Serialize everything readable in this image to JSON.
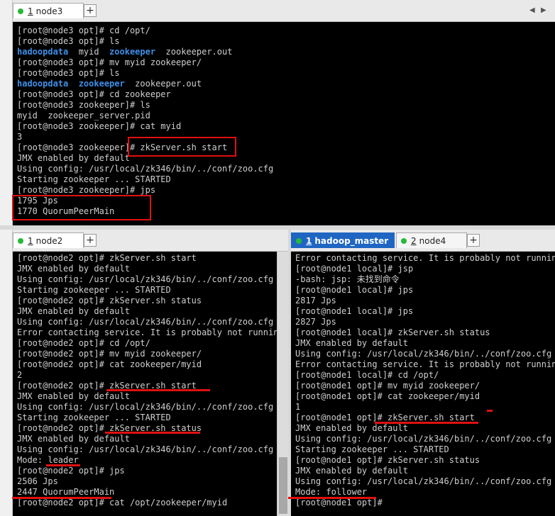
{
  "top_pane": {
    "tabs": [
      {
        "index": "1",
        "label": "node3",
        "active": true
      }
    ],
    "plus_label": "+",
    "nav_left_icon": "◀",
    "nav_right_icon": "▶",
    "lines": [
      [
        {
          "t": "[root@node3 opt]# cd /opt/"
        }
      ],
      [
        {
          "t": "[root@node3 opt]# ls"
        }
      ],
      [
        {
          "t": "hadoopdata",
          "c": "dir"
        },
        {
          "t": "  myid  "
        },
        {
          "t": "zookeeper",
          "c": "dir"
        },
        {
          "t": "  zookeeper.out"
        }
      ],
      [
        {
          "t": "[root@node3 opt]# mv myid zookeeper/"
        }
      ],
      [
        {
          "t": "[root@node3 opt]# ls"
        }
      ],
      [
        {
          "t": "hadoopdata",
          "c": "dir"
        },
        {
          "t": "  "
        },
        {
          "t": "zookeeper",
          "c": "dir"
        },
        {
          "t": "  zookeeper.out"
        }
      ],
      [
        {
          "t": "[root@node3 opt]# cd zookeeper"
        }
      ],
      [
        {
          "t": "[root@node3 zookeeper]# ls"
        }
      ],
      [
        {
          "t": "myid  zookeeper_server.pid"
        }
      ],
      [
        {
          "t": "[root@node3 zookeeper]# cat myid"
        }
      ],
      [
        {
          "t": "3"
        }
      ],
      [
        {
          "t": "[root@node3 zookeeper]# zkServer.sh start"
        }
      ],
      [
        {
          "t": "JMX enabled by default"
        }
      ],
      [
        {
          "t": "Using config: /usr/local/zk346/bin/../conf/zoo.cfg"
        }
      ],
      [
        {
          "t": "Starting zookeeper ... STARTED"
        }
      ],
      [
        {
          "t": "[root@node3 zookeeper]# jps"
        }
      ],
      [
        {
          "t": "1795 Jps"
        }
      ],
      [
        {
          "t": "1770 QuorumPeerMain"
        }
      ]
    ]
  },
  "left_pane": {
    "tabs": [
      {
        "index": "1",
        "label": "node2",
        "active": true
      }
    ],
    "plus_label": "+",
    "lines": [
      [
        {
          "t": "[root@node2 opt]# zkServer.sh start"
        }
      ],
      [
        {
          "t": "JMX enabled by default"
        }
      ],
      [
        {
          "t": "Using config: /usr/local/zk346/bin/../conf/zoo.cfg"
        }
      ],
      [
        {
          "t": "Starting zookeeper ... STARTED"
        }
      ],
      [
        {
          "t": "[root@node2 opt]# zkServer.sh status"
        }
      ],
      [
        {
          "t": "JMX enabled by default"
        }
      ],
      [
        {
          "t": "Using config: /usr/local/zk346/bin/../conf/zoo.cfg"
        }
      ],
      [
        {
          "t": "Error contacting service. It is probably not runnin"
        }
      ],
      [
        {
          "t": "[root@node2 opt]# cd /opt/"
        }
      ],
      [
        {
          "t": "[root@node2 opt]# mv myid zookeeper/"
        }
      ],
      [
        {
          "t": "[root@node2 opt]# cat zookeeper/myid"
        }
      ],
      [
        {
          "t": "2"
        }
      ],
      [
        {
          "t": "[root@node2 opt]# zkServer.sh start"
        }
      ],
      [
        {
          "t": "JMX enabled by default"
        }
      ],
      [
        {
          "t": "Using config: /usr/local/zk346/bin/../conf/zoo.cfg"
        }
      ],
      [
        {
          "t": "Starting zookeeper ... STARTED"
        }
      ],
      [
        {
          "t": "[root@node2 opt]# zkServer.sh status"
        }
      ],
      [
        {
          "t": "JMX enabled by default"
        }
      ],
      [
        {
          "t": "Using config: /usr/local/zk346/bin/../conf/zoo.cfg"
        }
      ],
      [
        {
          "t": "Mode: leader"
        }
      ],
      [
        {
          "t": "[root@node2 opt]# jps"
        }
      ],
      [
        {
          "t": "2506 Jps"
        }
      ],
      [
        {
          "t": "2447 QuorumPeerMain"
        }
      ],
      [
        {
          "t": "[root@node2 opt]# cat /opt/zookeeper/myid"
        }
      ]
    ]
  },
  "right_pane": {
    "tabs": [
      {
        "index": "1",
        "label": "hadoop_master",
        "active": true
      },
      {
        "index": "2",
        "label": "node4",
        "active": false
      }
    ],
    "plus_label": "+",
    "lines": [
      [
        {
          "t": "Error contacting service. It is probably not runnin"
        }
      ],
      [
        {
          "t": "[root@node1 local]# jsp"
        }
      ],
      [
        {
          "t": "-bash: jsp: 未找到命令"
        }
      ],
      [
        {
          "t": "[root@node1 local]# jps"
        }
      ],
      [
        {
          "t": "2817 Jps"
        }
      ],
      [
        {
          "t": "[root@node1 local]# jps"
        }
      ],
      [
        {
          "t": "2827 Jps"
        }
      ],
      [
        {
          "t": "[root@node1 local]# zkServer.sh status"
        }
      ],
      [
        {
          "t": "JMX enabled by default"
        }
      ],
      [
        {
          "t": "Using config: /usr/local/zk346/bin/../conf/zoo.cfg"
        }
      ],
      [
        {
          "t": "Error contacting service. It is probably not runnin"
        }
      ],
      [
        {
          "t": "[root@node1 local]# cd /opt/"
        }
      ],
      [
        {
          "t": "[root@node1 opt]# mv myid zookeeper/"
        }
      ],
      [
        {
          "t": "[root@node1 opt]# cat zookeeper/myid"
        }
      ],
      [
        {
          "t": "1"
        }
      ],
      [
        {
          "t": "[root@node1 opt]# zkServer.sh start"
        }
      ],
      [
        {
          "t": "JMX enabled by default"
        }
      ],
      [
        {
          "t": "Using config: /usr/local/zk346/bin/../conf/zoo.cfg"
        }
      ],
      [
        {
          "t": "Starting zookeeper ... STARTED"
        }
      ],
      [
        {
          "t": "[root@node1 opt]# zkServer.sh status"
        }
      ],
      [
        {
          "t": "JMX enabled by default"
        }
      ],
      [
        {
          "t": "Using config: /usr/local/zk346/bin/../conf/zoo.cfg"
        }
      ],
      [
        {
          "t": "Mode: follower"
        }
      ],
      [
        {
          "t": "[root@node1 opt]#"
        }
      ]
    ]
  },
  "colors": {
    "terminal_bg": "#000000",
    "terminal_fg": "#cfcfcf",
    "directory": "#3f8fe8",
    "annotation": "#e01010",
    "status_dot": "#27b83a",
    "highlight_tab": "#1f66c3"
  }
}
